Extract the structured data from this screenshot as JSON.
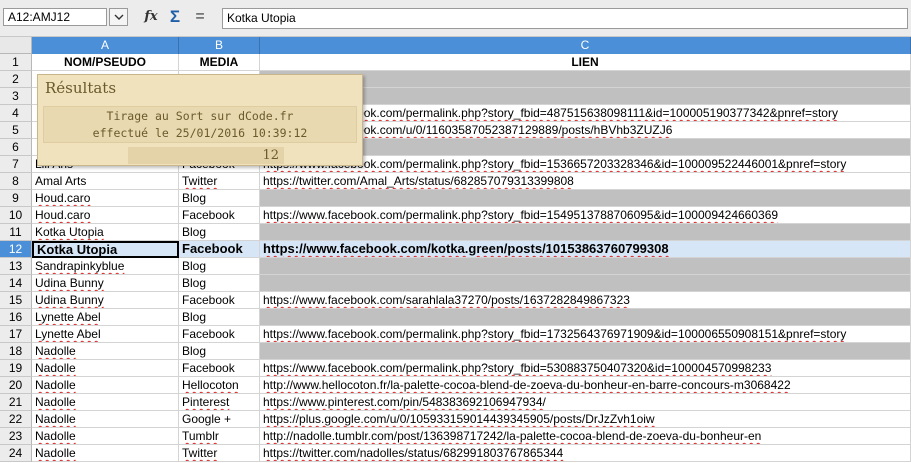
{
  "toolbar": {
    "name_box": "A12:AMJ12",
    "formula_value": "Kotka Utopia",
    "icons": [
      "function-wizard-icon",
      "sum-icon",
      "formula-icon"
    ],
    "fx_glyph": "fx",
    "sum_glyph": "Σ",
    "equals_glyph": "="
  },
  "sheet": {
    "columns": [
      "A",
      "B",
      "C"
    ],
    "row_numbers": [
      "1",
      "2",
      "3",
      "4",
      "5",
      "6",
      "7",
      "8",
      "9",
      "10",
      "11",
      "12",
      "13",
      "14",
      "15",
      "16",
      "17",
      "18",
      "19",
      "20",
      "21",
      "22",
      "23",
      "24"
    ],
    "active_row": "12",
    "header": {
      "a": "NOM/PSEUDO",
      "b": "MEDIA",
      "c": "LIEN"
    },
    "rows": [
      {
        "n": "2",
        "a": "",
        "b": "",
        "c": "",
        "gray_c": true
      },
      {
        "n": "3",
        "a": "",
        "b": "",
        "c": "",
        "gray_c": true
      },
      {
        "n": "4",
        "a": "",
        "b": "",
        "c": "https://www.facebook.com/permalink.php?story_fbid=487515638098111&id=100005190377342&pnref=story"
      },
      {
        "n": "5",
        "a": "",
        "b": "",
        "c": "https://www.facebook.com/u/0/116035870523871298​89/posts/hBVhb3ZUZJ6"
      },
      {
        "n": "6",
        "a": "",
        "b": "",
        "c": "",
        "gray_c": true
      },
      {
        "n": "7",
        "a": "Lili Aris",
        "b": "Facebook",
        "c": "https://www.facebook.com/permalink.php?story_fbid=1536657203328346&id=100009522446001&pnref=story"
      },
      {
        "n": "8",
        "a": "Amal Arts",
        "b": "Twitter",
        "c": "https://twitter.com/Amal_Arts/status/682857079313399808"
      },
      {
        "n": "9",
        "a": "Houd.caro",
        "b": "Blog",
        "c": "",
        "gray_c": true
      },
      {
        "n": "10",
        "a": "Houd.caro",
        "b": "Facebook",
        "c": "https://www.facebook.com/permalink.php?story_fbid=1549513788706095&id=100009424660369"
      },
      {
        "n": "11",
        "a": "Kotka Utopia",
        "b": "Blog",
        "c": "",
        "gray_c": true
      },
      {
        "n": "12",
        "a": "Kotka Utopia",
        "b": "Facebook",
        "c": "https://www.facebook.com/kotka.green/posts/10153863760799308"
      },
      {
        "n": "13",
        "a": "Sandrapinkyblue",
        "b": "Blog",
        "c": "",
        "gray_c": true
      },
      {
        "n": "14",
        "a": "Udina Bunny",
        "b": "Blog",
        "c": "",
        "gray_c": true
      },
      {
        "n": "15",
        "a": "Udina Bunny",
        "b": "Facebook",
        "c": "https://www.facebook.com/sarahlala37270/posts/1637282849867323"
      },
      {
        "n": "16",
        "a": "Lynette Abel",
        "b": "Blog",
        "c": "",
        "gray_c": true
      },
      {
        "n": "17",
        "a": "Lynette Abel",
        "b": "Facebook",
        "c": "https://www.facebook.com/permalink.php?story_fbid=1732564376971909&id=100006550908151&pnref=story"
      },
      {
        "n": "18",
        "a": "Nadolle",
        "b": "Blog",
        "c": "",
        "gray_c": true
      },
      {
        "n": "19",
        "a": "Nadolle",
        "b": "Facebook",
        "c": "https://www.facebook.com/permalink.php?story_fbid=530883750407320&id=100004570998233"
      },
      {
        "n": "20",
        "a": "Nadolle",
        "b": "Hellocoton",
        "c": "http://www.hellocoton.fr/la-palette-cocoa-blend-de-zoeva-du-bonheur-en-barre-concours-m3068422"
      },
      {
        "n": "21",
        "a": "Nadolle",
        "b": "Pinterest",
        "c": "https://www.pinterest.com/pin/548383692106947934/"
      },
      {
        "n": "22",
        "a": "Nadolle",
        "b": "Google +",
        "c": "https://plus.google.com/u/0/105933159014439345905/posts/DrJzZvh1oiw"
      },
      {
        "n": "23",
        "a": "Nadolle",
        "b": "Tumblr",
        "c": "http://nadolle.tumblr.com/post/136398717242/la-palette-cocoa-blend-de-zoeva-du-bonheur-en"
      },
      {
        "n": "24",
        "a": "Nadolle",
        "b": "Twitter",
        "c": "https://twitter.com/nadolles/status/682991803767865344"
      }
    ]
  },
  "popup": {
    "title": "Résultats",
    "line1": "Tirage au Sort sur dCode.fr",
    "line2": "effectué le 25/01/2016 10:39:12",
    "result": "12"
  },
  "colors": {
    "header_accent": "#4a8fd8",
    "gray_fill": "#c0c0c0",
    "popup_bg": "#f0e2bd",
    "selection": "#d6e6f6"
  }
}
